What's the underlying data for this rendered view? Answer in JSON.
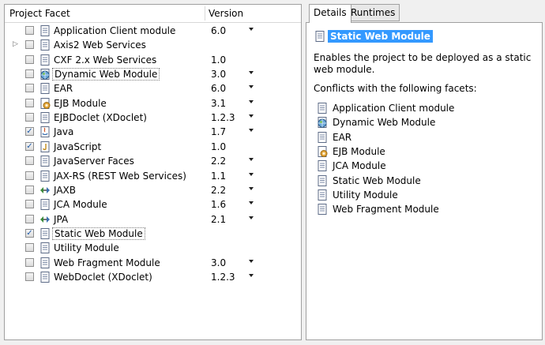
{
  "left": {
    "header": {
      "facet": "Project Facet",
      "version": "Version"
    },
    "rows": [
      {
        "label": "Application Client module",
        "version": "6.0",
        "dd": true,
        "checked": false,
        "icon": "doc"
      },
      {
        "label": "Axis2 Web Services",
        "version": "",
        "dd": false,
        "checked": false,
        "icon": "doc",
        "expander": true
      },
      {
        "label": "CXF 2.x Web Services",
        "version": "1.0",
        "dd": false,
        "checked": false,
        "icon": "doc"
      },
      {
        "label": "Dynamic Web Module",
        "version": "3.0",
        "dd": true,
        "checked": false,
        "icon": "globe",
        "selected": true
      },
      {
        "label": "EAR",
        "version": "6.0",
        "dd": true,
        "checked": false,
        "icon": "doc"
      },
      {
        "label": "EJB Module",
        "version": "3.1",
        "dd": true,
        "checked": false,
        "icon": "bean"
      },
      {
        "label": "EJBDoclet (XDoclet)",
        "version": "1.2.3",
        "dd": true,
        "checked": false,
        "icon": "doc"
      },
      {
        "label": "Java",
        "version": "1.7",
        "dd": true,
        "checked": true,
        "icon": "java"
      },
      {
        "label": "JavaScript",
        "version": "1.0",
        "dd": false,
        "checked": true,
        "icon": "js"
      },
      {
        "label": "JavaServer Faces",
        "version": "2.2",
        "dd": true,
        "checked": false,
        "icon": "doc"
      },
      {
        "label": "JAX-RS (REST Web Services)",
        "version": "1.1",
        "dd": true,
        "checked": false,
        "icon": "doc"
      },
      {
        "label": "JAXB",
        "version": "2.2",
        "dd": true,
        "checked": false,
        "icon": "arrows"
      },
      {
        "label": "JCA Module",
        "version": "1.6",
        "dd": true,
        "checked": false,
        "icon": "doc"
      },
      {
        "label": "JPA",
        "version": "2.1",
        "dd": true,
        "checked": false,
        "icon": "arrows"
      },
      {
        "label": "Static Web Module",
        "version": "",
        "dd": false,
        "checked": true,
        "icon": "doc",
        "selected": true
      },
      {
        "label": "Utility Module",
        "version": "",
        "dd": false,
        "checked": false,
        "icon": "doc"
      },
      {
        "label": "Web Fragment Module",
        "version": "3.0",
        "dd": true,
        "checked": false,
        "icon": "doc"
      },
      {
        "label": "WebDoclet (XDoclet)",
        "version": "1.2.3",
        "dd": true,
        "checked": false,
        "icon": "doc"
      }
    ]
  },
  "right": {
    "tabs": [
      "Details",
      "Runtimes"
    ],
    "title": "Static Web Module",
    "description": "Enables the project to be deployed as a static web module.",
    "conflicts_title": "Conflicts with the following facets:",
    "conflicts": [
      {
        "label": "Application Client module",
        "icon": "doc"
      },
      {
        "label": "Dynamic Web Module",
        "icon": "globe"
      },
      {
        "label": "EAR",
        "icon": "doc"
      },
      {
        "label": "EJB Module",
        "icon": "bean"
      },
      {
        "label": "JCA Module",
        "icon": "doc"
      },
      {
        "label": "Static Web Module",
        "icon": "doc"
      },
      {
        "label": "Utility Module",
        "icon": "doc"
      },
      {
        "label": "Web Fragment Module",
        "icon": "doc"
      }
    ]
  },
  "colors": {
    "selection": "#3399ff",
    "check": "#1e5aa8"
  }
}
